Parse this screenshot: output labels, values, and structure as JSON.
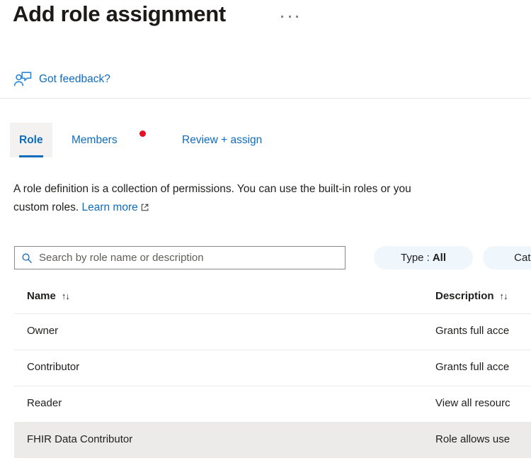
{
  "header": {
    "title": "Add role assignment",
    "more_options_label": "···",
    "feedback_label": "Got feedback?",
    "feedback_icon": "person-feedback-icon"
  },
  "tabs": {
    "items": [
      {
        "label": "Role",
        "active": true,
        "badge": false
      },
      {
        "label": "Members",
        "active": false,
        "badge": true
      },
      {
        "label": "Review + assign",
        "active": false,
        "badge": false
      }
    ]
  },
  "description": {
    "text_before_link": "A role definition is a collection of permissions. You can use the built-in roles or you\ncustom roles. ",
    "link_label": "Learn more",
    "link_icon": "external-link-icon"
  },
  "filters": {
    "search": {
      "placeholder": "Search by role name or description",
      "value": "",
      "icon": "search-icon"
    },
    "pills": [
      {
        "label": "Type :",
        "value": "All"
      },
      {
        "label": "Cate",
        "value": ""
      }
    ]
  },
  "table": {
    "columns": [
      {
        "label": "Name",
        "sort_glyph": "↑↓"
      },
      {
        "label": "Description",
        "sort_glyph": "↑↓"
      }
    ],
    "rows": [
      {
        "name": "Owner",
        "description": "Grants full acce",
        "selected": false
      },
      {
        "name": "Contributor",
        "description": "Grants full acce",
        "selected": false
      },
      {
        "name": "Reader",
        "description": "View all resourc",
        "selected": false
      },
      {
        "name": "FHIR Data Contributor",
        "description": "Role allows use",
        "selected": true
      }
    ]
  },
  "colors": {
    "accent": "#0f6cbd",
    "badge_red": "#e81123",
    "pill_bg": "#eff6fc",
    "row_selected_bg": "#edebe9"
  }
}
